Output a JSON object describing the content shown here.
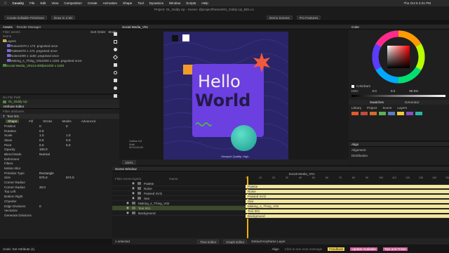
{
  "menubar": {
    "items": [
      "Cavalry",
      "File",
      "Edit",
      "View",
      "Composition",
      "Create",
      "Animation",
      "Shape",
      "Tool",
      "Dynamics",
      "Window",
      "Scripts",
      "Help"
    ],
    "title": "Project: 01_Giddy Up - Scene: @project/frames/01_Giddy Up_B01.cv",
    "clock": "Thu Oct 9  4:21 PM"
  },
  "toolbar": {
    "left_btn": "Create Editable Primitives",
    "left_btn2": "Draw in 2.5D",
    "demo_btn": "Demo Scenes",
    "pro_btn": "Pro Features"
  },
  "assets": {
    "tabs": [
      "Assets",
      "Render Manager"
    ],
    "search_placeholder": "Filter assets",
    "sort_label": "Sort Order",
    "mode_label": "Mode",
    "col_name": "Name",
    "rows": [
      {
        "name": "Layers",
        "size": "",
        "status": ""
      },
      {
        "name": "Texture",
        "size": "570 x 173 .png",
        "status": "Used once"
      },
      {
        "name": "Palette",
        "size": "570 x 173 .png",
        "status": "Used once"
      },
      {
        "name": "Noise",
        "size": "1000 x 1150 .png",
        "status": "Used once"
      },
      {
        "name": "Making_s_Thing_V02",
        "size": "1000 x 1150 .png",
        "status": "Used once"
      },
      {
        "name": "Social Media_V01",
        "size": "24.000fps",
        "status": "1000 x 1150"
      }
    ]
  },
  "attribute_editor": {
    "file_path": "No File Path",
    "comp_name": "01_Giddy Up",
    "tabs": [
      "Attribute Editor"
    ],
    "filter_placeholder": "Filter attributes",
    "layer_name": "Text 001",
    "subtabs": [
      "Shape",
      "Fill",
      "Stroke",
      "Masks",
      "Advanced"
    ],
    "props": [
      {
        "label": "Position",
        "v1": "0",
        "v2": "0"
      },
      {
        "label": "Rotation",
        "v1": "0.0",
        "v2": ""
      },
      {
        "label": "Scale",
        "v1": "1.0",
        "v2": "1.0"
      },
      {
        "label": "Skew",
        "v1": "0.0",
        "v2": "0.0"
      },
      {
        "label": "Pivot",
        "v1": "0.0",
        "v2": "0.0"
      },
      {
        "label": "Opacity",
        "v1": "100.0",
        "v2": ""
      },
      {
        "label": "Blend Mode",
        "v1": "Normal",
        "v2": ""
      },
      {
        "label": "Deformers",
        "v1": "",
        "v2": ""
      },
      {
        "label": "Filters",
        "v1": "",
        "v2": ""
      },
      {
        "label": "Motion Blur",
        "v1": "",
        "v2": ""
      },
      {
        "label": "Primitive Type",
        "v1": "Rectangle",
        "v2": ""
      },
      {
        "label": "Size",
        "v1": "675.0",
        "v2": "674.0"
      },
      {
        "label": "Corner Radius",
        "v1": "",
        "v2": ""
      },
      {
        "label": "Corner Radius",
        "v1": "20.0",
        "v2": ""
      },
      {
        "label": "Top Left",
        "v1": "",
        "v2": ""
      },
      {
        "label": "Bottom Right",
        "v1": "",
        "v2": ""
      },
      {
        "label": "Chamfer",
        "v1": "",
        "v2": ""
      },
      {
        "label": "Edge Divisions",
        "v1": "0",
        "v2": ""
      },
      {
        "label": "Vectorize",
        "v1": "",
        "v2": ""
      },
      {
        "label": "Generate Divisions",
        "v1": "",
        "v2": ""
      }
    ]
  },
  "viewport": {
    "tab": "Social Media_V01",
    "headline1": "Hello",
    "headline2": "World",
    "info_lines": [
      "Outline 0/4",
      "Shift",
      "00:00:00:00"
    ],
    "quality_label": "Viewport Quality: High",
    "zoom": "100%"
  },
  "color_panel": {
    "tab": "Color",
    "mode_labels": [
      "HSV",
      "RGB",
      "HEX"
    ],
    "values": [
      "0.0",
      "0.0",
      "90.5%"
    ],
    "cmyk_label": "Colorbars",
    "swatches_tab": "Swatches",
    "generator_tab": "Generator",
    "sub_tabs": [
      "Library",
      "Project",
      "Scene",
      "Layers"
    ],
    "swatch_colors": [
      "#e05a2b",
      "#c34a3e",
      "#d66b2a",
      "#5fae5a",
      "#5a7fbe",
      "#f0c63a",
      "#8a4cc0",
      "#2bb5a8"
    ]
  },
  "align_panel": {
    "tab": "Align",
    "alignment_label": "Alignment",
    "distribution_label": "Distribution"
  },
  "timeline": {
    "tab": "Scene Window",
    "comp_title": "Social Media_V01",
    "col_name": "Name",
    "filter_placeholder": "Filter scene layers",
    "layers": [
      {
        "name": "Palette",
        "indent": 1
      },
      {
        "name": "Noise",
        "indent": 1
      },
      {
        "name": "Passed SVG",
        "indent": 1
      },
      {
        "name": "Star",
        "indent": 1
      },
      {
        "name": "Making_s_Thing_V02",
        "indent": 0
      },
      {
        "name": "Text 001",
        "indent": 0
      },
      {
        "name": "Background",
        "indent": 0
      }
    ],
    "bars": [
      "Palette",
      "Noise",
      "Passed SVG",
      "Star",
      "Making_s_Thing_V02",
      "Text 001",
      "Background"
    ],
    "ticks": [
      "0",
      "10",
      "20",
      "30",
      "40",
      "50",
      "60",
      "70",
      "80",
      "90",
      "100",
      "110",
      "120",
      "130",
      "140",
      "150"
    ]
  },
  "statusbar": {
    "selected": "1 selected",
    "undo": "Undo: Set Attribute (1)",
    "time_editor": "Time Editor",
    "graph_editor": "Graph Editor",
    "keyframe_layer": "Default Keyframe Layer",
    "align_label": "Align",
    "message": "Click to see next message",
    "feedback": "Feedback",
    "update": "Update Available",
    "tips": "Tips and Tricks"
  },
  "colors": {
    "accent": "#f2d64b",
    "selection": "#3b4a2a",
    "timeline_bar": "#f1e6a0",
    "viewport_bg": "#2a2568",
    "card": "#6b3fe0"
  }
}
